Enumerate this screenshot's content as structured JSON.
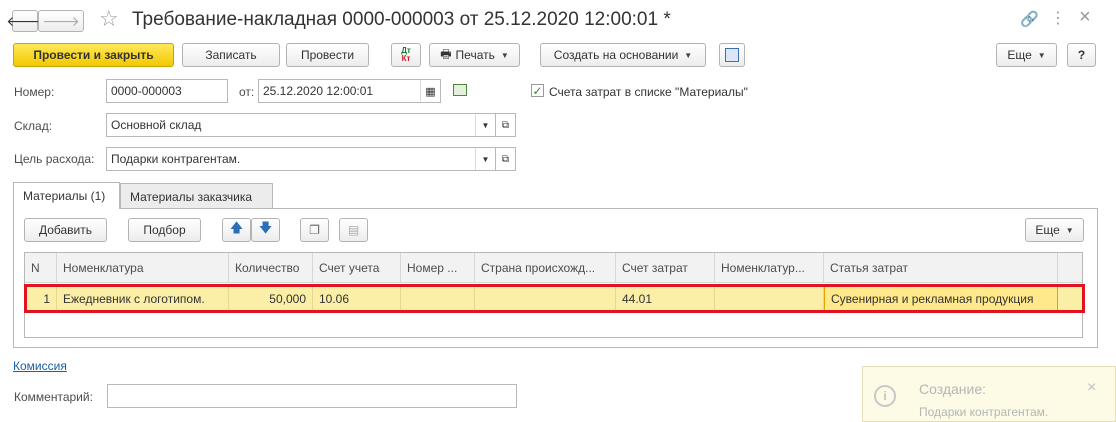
{
  "window": {
    "title": "Требование-накладная 0000-000003 от 25.12.2020 12:00:01 *"
  },
  "toolbar": {
    "post_close": "Провести и закрыть",
    "save": "Записать",
    "post": "Провести",
    "dtkt_top": "Дт",
    "dtkt_bottom": "Кт",
    "print": "Печать",
    "create_based": "Создать на основании",
    "more": "Еще",
    "help": "?"
  },
  "form": {
    "number_label": "Номер:",
    "number_value": "0000-000003",
    "date_label": "от:",
    "date_value": "25.12.2020 12:00:01",
    "cost_accounts_label": "Счета затрат в списке \"Материалы\"",
    "warehouse_label": "Склад:",
    "warehouse_value": "Основной склад",
    "purpose_label": "Цель расхода:",
    "purpose_value": "Подарки контрагентам."
  },
  "tabs": [
    {
      "label": "Материалы (1)"
    },
    {
      "label": "Материалы заказчика"
    }
  ],
  "table_toolbar": {
    "add": "Добавить",
    "select": "Подбор",
    "more": "Еще"
  },
  "table": {
    "columns": [
      "N",
      "Номенклатура",
      "Количество",
      "Счет учета",
      "Номер ...",
      "Страна происхожд...",
      "Счет затрат",
      "Номенклатур...",
      "Статья затрат"
    ],
    "rows": [
      [
        "1",
        "Ежедневник с логотипом.",
        "50,000",
        "10.06",
        "",
        "",
        "44.01",
        "",
        "Сувенирная и рекламная продукция"
      ]
    ]
  },
  "footer": {
    "commission_link": "Комиссия",
    "comment_label": "Комментарий:",
    "comment_value": ""
  },
  "notification": {
    "title": "Создание:",
    "text": "Подарки контрагентам.",
    "close": "×"
  },
  "colors": {
    "accent_yellow": "#f2c800",
    "row_highlight": "#fbeea7",
    "selection_border": "#e0141e",
    "link": "#1a5fa8"
  }
}
